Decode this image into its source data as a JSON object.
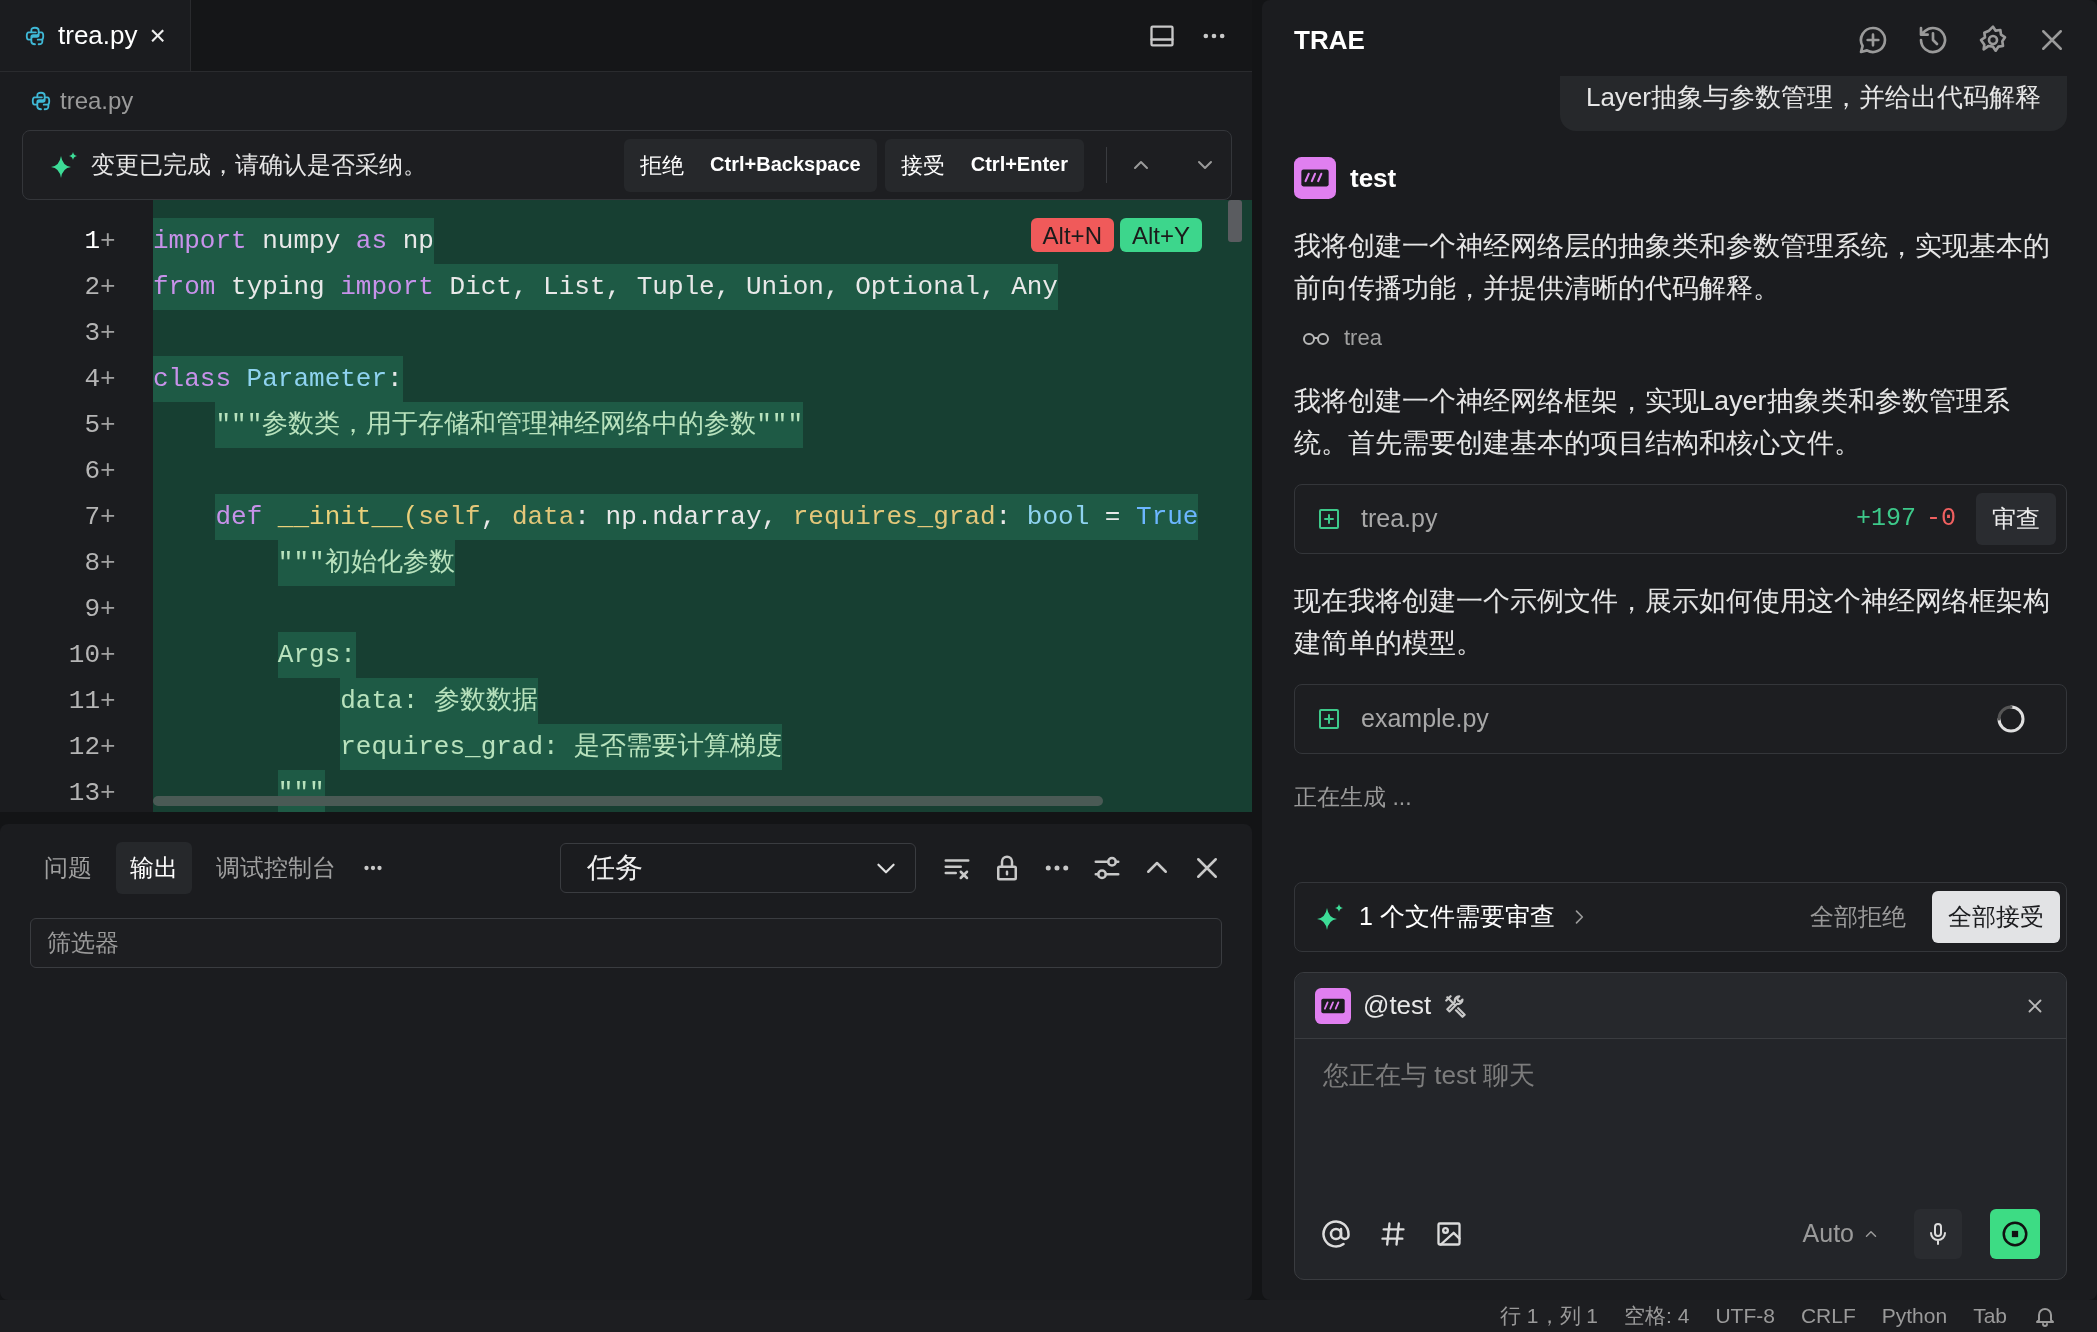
{
  "editor": {
    "tab": {
      "label": "trea.py",
      "selected": true,
      "close": "×"
    },
    "breadcrumb": "trea.py",
    "diff_bar": {
      "message": "变更已完成，请确认是否采纳。",
      "actions": [
        {
          "label": "拒绝",
          "shortcut": "Ctrl+Backspace"
        },
        {
          "label": "接受",
          "shortcut": "Ctrl+Enter"
        }
      ]
    },
    "hunk_actions": [
      {
        "label": "Alt+N",
        "kind": "reject"
      },
      {
        "label": "Alt+Y",
        "kind": "accept"
      }
    ],
    "lines": [
      {
        "number": "1",
        "marker": "+",
        "tokens": [
          {
            "text": "import",
            "kind": "keyword"
          },
          {
            "text": " numpy ",
            "kind": "plain"
          },
          {
            "text": "as",
            "kind": "keyword"
          },
          {
            "text": " np",
            "kind": "plain"
          }
        ]
      },
      {
        "number": "2",
        "marker": "+",
        "tokens": [
          {
            "text": "from",
            "kind": "keyword"
          },
          {
            "text": " typing ",
            "kind": "plain"
          },
          {
            "text": "import",
            "kind": "keyword"
          },
          {
            "text": " Dict, List, Tuple, Union, Optional, Any",
            "kind": "plain"
          }
        ]
      },
      {
        "number": "3",
        "marker": "+"
      },
      {
        "number": "4",
        "marker": "+",
        "tokens": [
          {
            "text": "class",
            "kind": "keyword"
          },
          {
            "text": " Parameter",
            "kind": "class"
          },
          {
            "text": ":",
            "kind": "plain"
          }
        ]
      },
      {
        "number": "5",
        "marker": "+",
        "tokens": [
          {
            "text": "    \"\"\"参数类，用于存储和管理神经网络中的参数\"\"\"",
            "kind": "string"
          }
        ]
      },
      {
        "number": "6",
        "marker": "+"
      },
      {
        "number": "7",
        "marker": "+",
        "tokens": [
          {
            "text": "    def",
            "kind": "keyword"
          },
          {
            "text": " __init__(",
            "kind": "function"
          },
          {
            "text": "self",
            "kind": "param"
          },
          {
            "text": ", ",
            "kind": "plain"
          },
          {
            "text": "data",
            "kind": "param"
          },
          {
            "text": ": np.ndarray, ",
            "kind": "plain"
          },
          {
            "text": "requires_grad",
            "kind": "param"
          },
          {
            "text": ": ",
            "kind": "plain"
          },
          {
            "text": "bool",
            "kind": "type"
          },
          {
            "text": " = ",
            "kind": "plain"
          },
          {
            "text": "True",
            "kind": "constant"
          }
        ]
      },
      {
        "number": "8",
        "marker": "+",
        "tokens": [
          {
            "text": "        \"\"\"初始化参数",
            "kind": "string"
          }
        ]
      },
      {
        "number": "9",
        "marker": "+"
      },
      {
        "number": "10",
        "marker": "+",
        "tokens": [
          {
            "text": "        Args:",
            "kind": "string"
          }
        ]
      },
      {
        "number": "11",
        "marker": "+",
        "tokens": [
          {
            "text": "            data: 参数数据",
            "kind": "string"
          }
        ]
      },
      {
        "number": "12",
        "marker": "+",
        "tokens": [
          {
            "text": "            requires_grad: 是否需要计算梯度",
            "kind": "string"
          }
        ]
      },
      {
        "number": "13",
        "marker": "+",
        "tokens": [
          {
            "text": "        \"\"\"",
            "kind": "string"
          }
        ]
      }
    ]
  },
  "panel": {
    "tabs": [
      {
        "label": "问题",
        "selected": false
      },
      {
        "label": "输出",
        "selected": true
      },
      {
        "label": "调试控制台",
        "selected": false
      }
    ],
    "channel": "任务",
    "filter": {
      "placeholder": "筛选器"
    }
  },
  "assistant": {
    "title": "TRAE",
    "user_message": "Layer抽象与参数管理，并给出代码解释",
    "agent": "test",
    "messages": [
      {
        "kind": "text",
        "text": "我将创建一个神经网络层的抽象类和参数管理系统，实现基本的前向传播功能，并提供清晰的代码解释。"
      },
      {
        "kind": "step",
        "text": "trea"
      },
      {
        "kind": "text",
        "text": "我将创建一个神经网络框架，实现Layer抽象类和参数管理系统。首先需要创建基本的项目结构和核心文件。"
      },
      {
        "kind": "file",
        "name": "trea.py",
        "loading": false,
        "added": "+197",
        "removed": "-0",
        "action": "审查"
      },
      {
        "kind": "text",
        "text": "现在我将创建一个示例文件，展示如何使用这个神经网络框架构建简单的模型。"
      },
      {
        "kind": "file",
        "name": "example.py",
        "loading": true
      },
      {
        "kind": "status",
        "text": "正在生成 ..."
      }
    ],
    "review": {
      "summary": "1 个文件需要审查",
      "reject_all": "全部拒绝",
      "accept_all": "全部接受"
    },
    "composer": {
      "mention": "@test",
      "placeholder": "您正在与 test 聊天",
      "model": "Auto"
    }
  },
  "status_bar": [
    "行 1，列 1",
    "空格: 4",
    "UTF-8",
    "CRLF",
    "Python",
    "Tab"
  ]
}
